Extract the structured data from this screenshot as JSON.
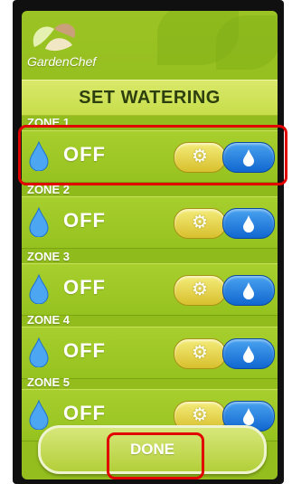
{
  "brand": {
    "name": "GardenChef"
  },
  "title": "SET WATERING",
  "zones": [
    {
      "label": "ZONE 1",
      "status": "OFF"
    },
    {
      "label": "ZONE 2",
      "status": "OFF"
    },
    {
      "label": "ZONE 3",
      "status": "OFF"
    },
    {
      "label": "ZONE 4",
      "status": "OFF"
    },
    {
      "label": "ZONE 5",
      "status": "OFF"
    }
  ],
  "done_label": "DONE",
  "colors": {
    "accent_green": "#96c21f",
    "water_blue": "#1167cf",
    "settings_yellow": "#d8c02d",
    "highlight_red": "#e10000"
  }
}
